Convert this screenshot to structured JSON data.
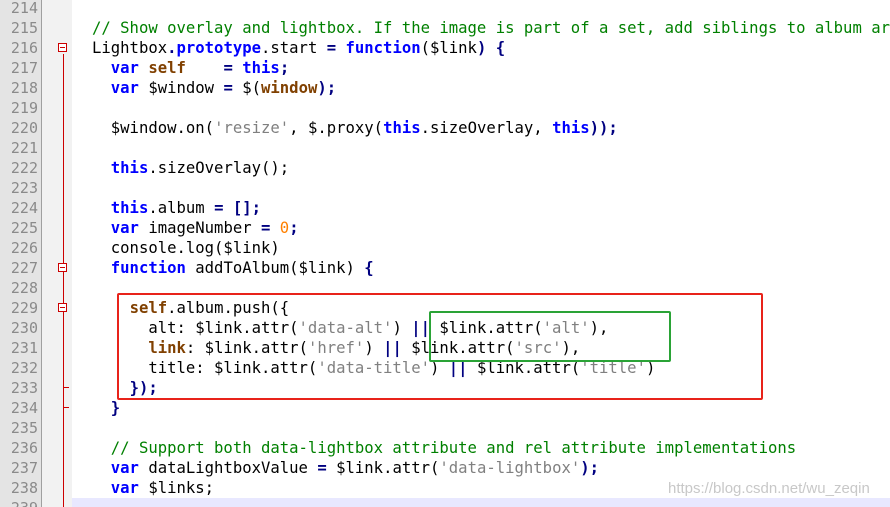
{
  "editor": {
    "lines": [
      {
        "num": "214",
        "tokens": []
      },
      {
        "num": "215",
        "tokens": [
          {
            "t": "// Show overlay and lightbox. If the image is part of a set, add siblings to album array.",
            "c": "cm"
          }
        ]
      },
      {
        "num": "216",
        "tokens": [
          {
            "t": "Lightbox"
          },
          {
            "t": ".",
            "c": "op"
          },
          {
            "t": "prototype",
            "c": "kw"
          },
          {
            "t": ".start "
          },
          {
            "t": "=",
            "c": "op"
          },
          {
            "t": " "
          },
          {
            "t": "function",
            "c": "kw"
          },
          {
            "t": "("
          },
          {
            "t": "$link"
          },
          {
            "t": ") {",
            "c": "op"
          }
        ]
      },
      {
        "num": "217",
        "tokens": [
          {
            "t": "  "
          },
          {
            "t": "var",
            "c": "kw"
          },
          {
            "t": " "
          },
          {
            "t": "self",
            "c": "pr"
          },
          {
            "t": "    "
          },
          {
            "t": "=",
            "c": "op"
          },
          {
            "t": " "
          },
          {
            "t": "this",
            "c": "kw"
          },
          {
            "t": ";",
            "c": "op"
          }
        ]
      },
      {
        "num": "218",
        "tokens": [
          {
            "t": "  "
          },
          {
            "t": "var",
            "c": "kw"
          },
          {
            "t": " $window "
          },
          {
            "t": "=",
            "c": "op"
          },
          {
            "t": " $("
          },
          {
            "t": "window",
            "c": "pr"
          },
          {
            "t": ");",
            "c": "op"
          }
        ]
      },
      {
        "num": "219",
        "tokens": []
      },
      {
        "num": "220",
        "tokens": [
          {
            "t": "  $window.on("
          },
          {
            "t": "'resize'",
            "c": "st"
          },
          {
            "t": ", $.proxy("
          },
          {
            "t": "this",
            "c": "kw"
          },
          {
            "t": ".sizeOverlay, "
          },
          {
            "t": "this",
            "c": "kw"
          },
          {
            "t": "));",
            "c": "op"
          }
        ]
      },
      {
        "num": "221",
        "tokens": []
      },
      {
        "num": "222",
        "tokens": [
          {
            "t": "  "
          },
          {
            "t": "this",
            "c": "kw"
          },
          {
            "t": ".sizeOverlay();"
          }
        ]
      },
      {
        "num": "223",
        "tokens": []
      },
      {
        "num": "224",
        "tokens": [
          {
            "t": "  "
          },
          {
            "t": "this",
            "c": "kw"
          },
          {
            "t": ".album "
          },
          {
            "t": "= [];",
            "c": "op"
          }
        ]
      },
      {
        "num": "225",
        "tokens": [
          {
            "t": "  "
          },
          {
            "t": "var",
            "c": "kw"
          },
          {
            "t": " imageNumber "
          },
          {
            "t": "=",
            "c": "op"
          },
          {
            "t": " "
          },
          {
            "t": "0",
            "c": "nm"
          },
          {
            "t": ";",
            "c": "op"
          }
        ]
      },
      {
        "num": "226",
        "tokens": [
          {
            "t": "  console.log($link)"
          }
        ]
      },
      {
        "num": "227",
        "tokens": [
          {
            "t": "  "
          },
          {
            "t": "function",
            "c": "kw"
          },
          {
            "t": " addToAlbum($link) "
          },
          {
            "t": "{",
            "c": "op"
          }
        ]
      },
      {
        "num": "228",
        "tokens": []
      },
      {
        "num": "229",
        "tokens": [
          {
            "t": "    "
          },
          {
            "t": "self",
            "c": "pr"
          },
          {
            "t": ".album.push({"
          }
        ]
      },
      {
        "num": "230",
        "tokens": [
          {
            "t": "      alt: $link.attr("
          },
          {
            "t": "'data-alt'",
            "c": "st"
          },
          {
            "t": ") "
          },
          {
            "t": "||",
            "c": "op"
          },
          {
            "t": " $link.attr("
          },
          {
            "t": "'alt'",
            "c": "st"
          },
          {
            "t": "),"
          }
        ]
      },
      {
        "num": "231",
        "tokens": [
          {
            "t": "      "
          },
          {
            "t": "link",
            "c": "pr"
          },
          {
            "t": ": $link.attr("
          },
          {
            "t": "'href'",
            "c": "st"
          },
          {
            "t": ") "
          },
          {
            "t": "||",
            "c": "op"
          },
          {
            "t": " $link.attr("
          },
          {
            "t": "'src'",
            "c": "st"
          },
          {
            "t": "),"
          }
        ]
      },
      {
        "num": "232",
        "tokens": [
          {
            "t": "      title: $link.attr("
          },
          {
            "t": "'data-title'",
            "c": "st"
          },
          {
            "t": ") "
          },
          {
            "t": "||",
            "c": "op"
          },
          {
            "t": " $link.attr("
          },
          {
            "t": "'title'",
            "c": "st"
          },
          {
            "t": ")"
          }
        ]
      },
      {
        "num": "233",
        "tokens": [
          {
            "t": "    "
          },
          {
            "t": "});",
            "c": "op"
          }
        ]
      },
      {
        "num": "234",
        "tokens": [
          {
            "t": "  "
          },
          {
            "t": "}",
            "c": "op"
          }
        ]
      },
      {
        "num": "235",
        "tokens": []
      },
      {
        "num": "236",
        "tokens": [
          {
            "t": "  // Support both data-lightbox attribute and rel attribute implementations",
            "c": "cm"
          }
        ]
      },
      {
        "num": "237",
        "tokens": [
          {
            "t": "  "
          },
          {
            "t": "var",
            "c": "kw"
          },
          {
            "t": " dataLightboxValue "
          },
          {
            "t": "=",
            "c": "op"
          },
          {
            "t": " $link.attr("
          },
          {
            "t": "'data-lightbox'",
            "c": "st"
          },
          {
            "t": ");",
            "c": "op"
          }
        ]
      },
      {
        "num": "238",
        "tokens": [
          {
            "t": "  "
          },
          {
            "t": "var",
            "c": "kw"
          },
          {
            "t": " $links;"
          }
        ]
      },
      {
        "num": "239",
        "tokens": []
      }
    ]
  },
  "watermark": "https://blog.csdn.net/wu_zeqin",
  "colors": {
    "keyword": "#0000ff",
    "comment": "#008000",
    "string": "#808080",
    "number": "#ff8000",
    "highlight_red": "#e8231a",
    "highlight_green": "#2aa336"
  }
}
